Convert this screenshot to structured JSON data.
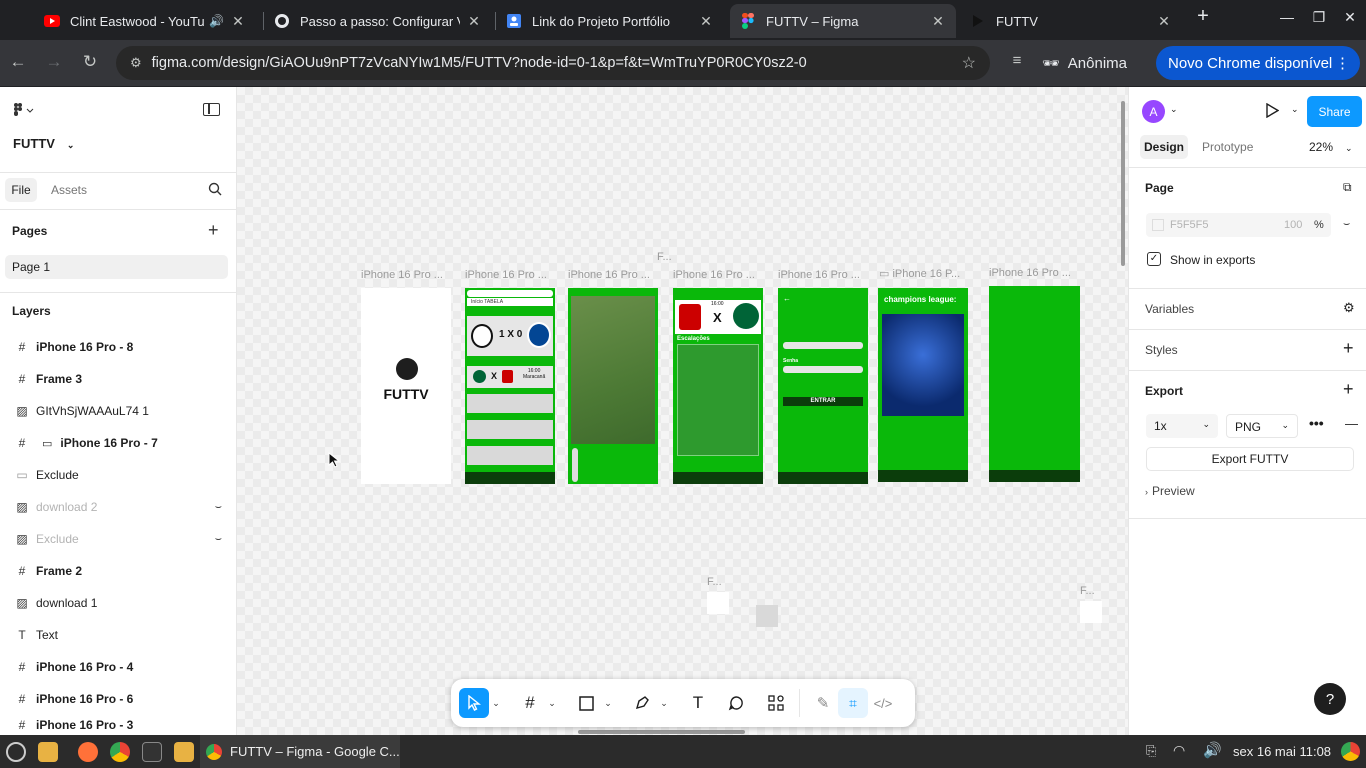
{
  "browser": {
    "tabs": [
      {
        "title": "Clint Eastwood - YouTube",
        "icon": "youtube-icon"
      },
      {
        "title": "Passo a passo: Configurar V",
        "icon": "github-icon"
      },
      {
        "title": "Link do Projeto Portfólio",
        "icon": "doc-icon"
      },
      {
        "title": "FUTTV – Figma",
        "icon": "figma-icon"
      },
      {
        "title": "FUTTV",
        "icon": "play-icon"
      }
    ],
    "url": "figma.com/design/GiAOUu9nPT7zVcaNYIw1M5/FUTTV?node-id=0-1&p=f&t=WmTruYP0R0CY0sz2-0",
    "profile_label": "Anônima",
    "update_label": "Novo Chrome disponível"
  },
  "figma": {
    "file_name": "FUTTV",
    "tabs": {
      "file": "File",
      "assets": "Assets"
    },
    "pages_title": "Pages",
    "pages": [
      "Page 1"
    ],
    "layers_title": "Layers",
    "layers": [
      {
        "name": "iPhone 16 Pro - 8",
        "type": "frame"
      },
      {
        "name": "Frame 3",
        "type": "frame"
      },
      {
        "name": "GItVhSjWAAAuL74 1",
        "type": "image"
      },
      {
        "name": "iPhone 16 Pro - 7",
        "type": "frame"
      },
      {
        "name": "Exclude",
        "type": "shape"
      },
      {
        "name": "download 2",
        "type": "image",
        "hidden": true
      },
      {
        "name": "Exclude",
        "type": "image",
        "hidden": true
      },
      {
        "name": "Frame 2",
        "type": "frame"
      },
      {
        "name": "download 1",
        "type": "image"
      },
      {
        "name": "Text",
        "type": "text"
      },
      {
        "name": "iPhone 16 Pro - 4",
        "type": "frame"
      },
      {
        "name": "iPhone 16 Pro - 6",
        "type": "frame"
      },
      {
        "name": "iPhone 16 Pro - 3",
        "type": "frame"
      }
    ],
    "canvas": {
      "frame_labels": [
        "iPhone 16 Pro ...",
        "iPhone 16 Pro ...",
        "iPhone 16 Pro ...",
        "iPhone 16 Pro ...",
        "iPhone 16 Pro ...",
        "iPhone 16 P...",
        "iPhone 16 Pro ..."
      ],
      "top_label": "F...",
      "mid_label": "F...",
      "right_label": "F...",
      "logo_text": "FUTTV",
      "tab_strip_text": "Início   TABELA",
      "score": "1 X 0",
      "match_time": "16:00",
      "match_place": "Maracanã",
      "vs": "X",
      "lineups": "Escalações",
      "password_label": "Senha",
      "enter_button": "ENTRAR",
      "champions_title": "champions league:"
    },
    "right": {
      "avatar_letter": "A",
      "share": "Share",
      "tab_design": "Design",
      "tab_prototype": "Prototype",
      "zoom": "22%",
      "page_title": "Page",
      "bg_hex": "F5F5F5",
      "bg_opacity": "100",
      "percent": "%",
      "show_in_exports": "Show in exports",
      "variables": "Variables",
      "styles": "Styles",
      "export_title": "Export",
      "export_scale": "1x",
      "export_format": "PNG",
      "export_button": "Export FUTTV",
      "preview": "Preview"
    }
  },
  "taskbar": {
    "active_window": "FUTTV – Figma - Google C...",
    "clock": "sex 16 mai 11:08"
  },
  "colors": {
    "figma_blue": "#0d99ff",
    "phone_green": "#0ab80a",
    "chrome_blue": "#0b57d0"
  }
}
